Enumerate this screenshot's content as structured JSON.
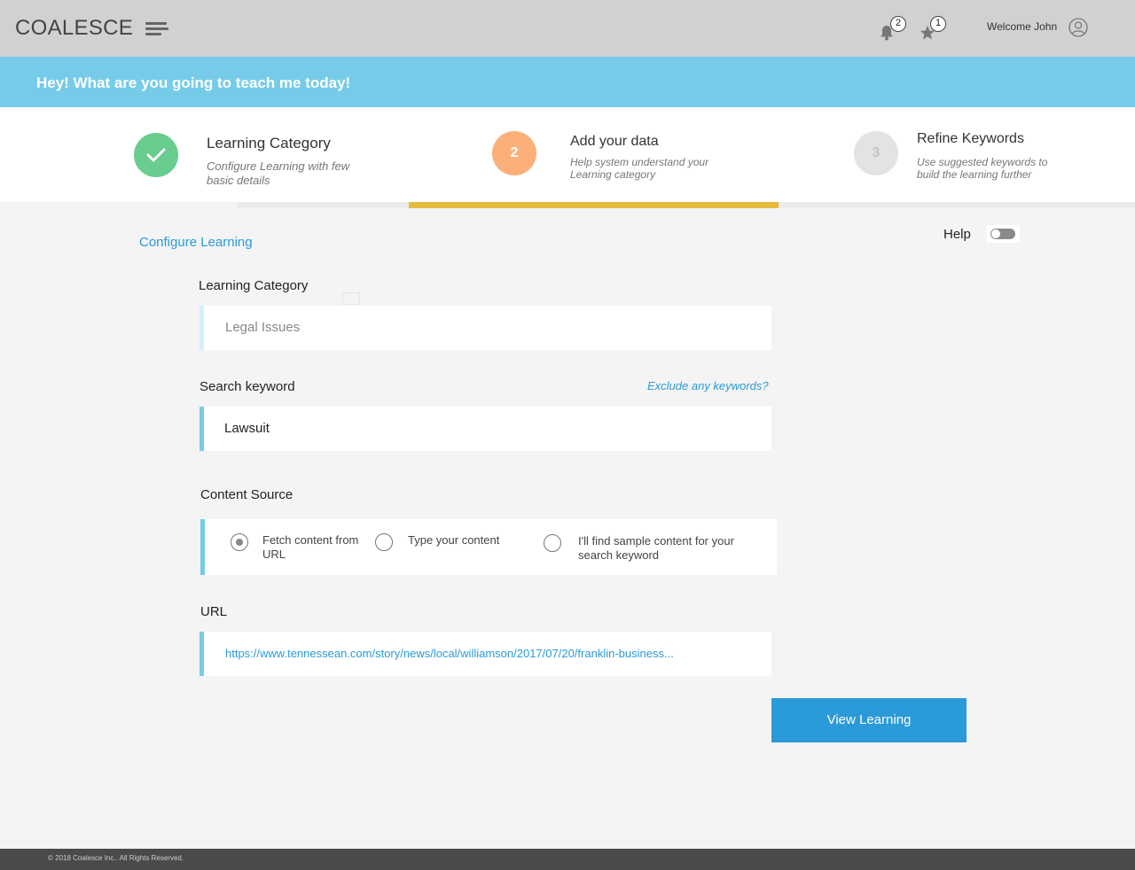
{
  "header": {
    "brand": "COALESCE",
    "notifications_count": "2",
    "favorites_count": "1",
    "welcome": "Welcome John"
  },
  "banner": {
    "text": "Hey! What are you going to teach me today!"
  },
  "steps": [
    {
      "number": "",
      "title": "Learning Category",
      "subtitle": "Configure Learning with few basic details",
      "state": "done",
      "color": "#68cd8e"
    },
    {
      "number": "2",
      "title": "Add your data",
      "subtitle": "Help system understand your Learning category",
      "state": "active",
      "color": "#fbb07a"
    },
    {
      "number": "3",
      "title": "Refine Keywords",
      "subtitle": "Use suggested keywords to build the learning further",
      "state": "pending",
      "color": "#e3e3e3"
    }
  ],
  "progress_color": "#e5bb3c",
  "form": {
    "section_link": "Configure Learning",
    "help_label": "Help",
    "help_enabled": false,
    "category_label": "Learning Category",
    "category_value": "Legal Issues",
    "keyword_label": "Search keyword",
    "keyword_value": "Lawsuit",
    "exclude_link": "Exclude any keywords?",
    "source_label": "Content Source",
    "source_options": [
      {
        "label": "Fetch content from URL",
        "checked": true
      },
      {
        "label": "Type your content",
        "checked": false
      },
      {
        "label": "I'll find sample content for your search keyword",
        "checked": false
      }
    ],
    "url_label": "URL",
    "url_value": "https://www.tennessean.com/story/news/local/williamson/2017/07/20/franklin-business...",
    "submit_label": "View Learning"
  },
  "footer": {
    "text": "© 2018 Coalesce Inc.. All Rights Reserved."
  },
  "colors": {
    "accent": "#2b9ad8",
    "banner": "#76cbe9",
    "topbar": "#d1d1d1"
  }
}
